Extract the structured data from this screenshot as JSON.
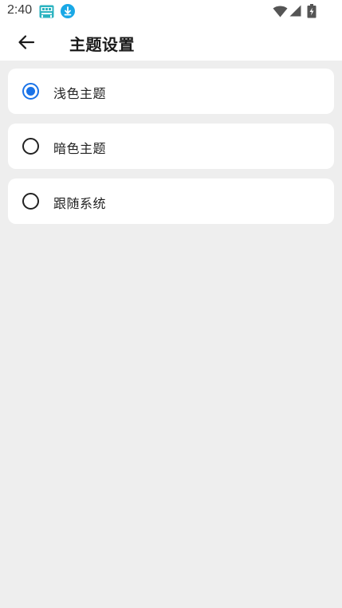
{
  "status_bar": {
    "time": "2:40",
    "app_icon": "app-notification-icon",
    "download_icon": "download-icon",
    "wifi_icon": "wifi-icon",
    "signal_icon": "cell-signal-icon",
    "battery_icon": "battery-charging-icon"
  },
  "app_bar": {
    "back_icon": "arrow-left-icon",
    "title": "主题设置"
  },
  "options": [
    {
      "label": "浅色主题",
      "selected": true
    },
    {
      "label": "暗色主题",
      "selected": false
    },
    {
      "label": "跟随系统",
      "selected": false
    }
  ],
  "colors": {
    "accent": "#1a73e8",
    "background": "#eeeeee",
    "card": "#ffffff"
  }
}
